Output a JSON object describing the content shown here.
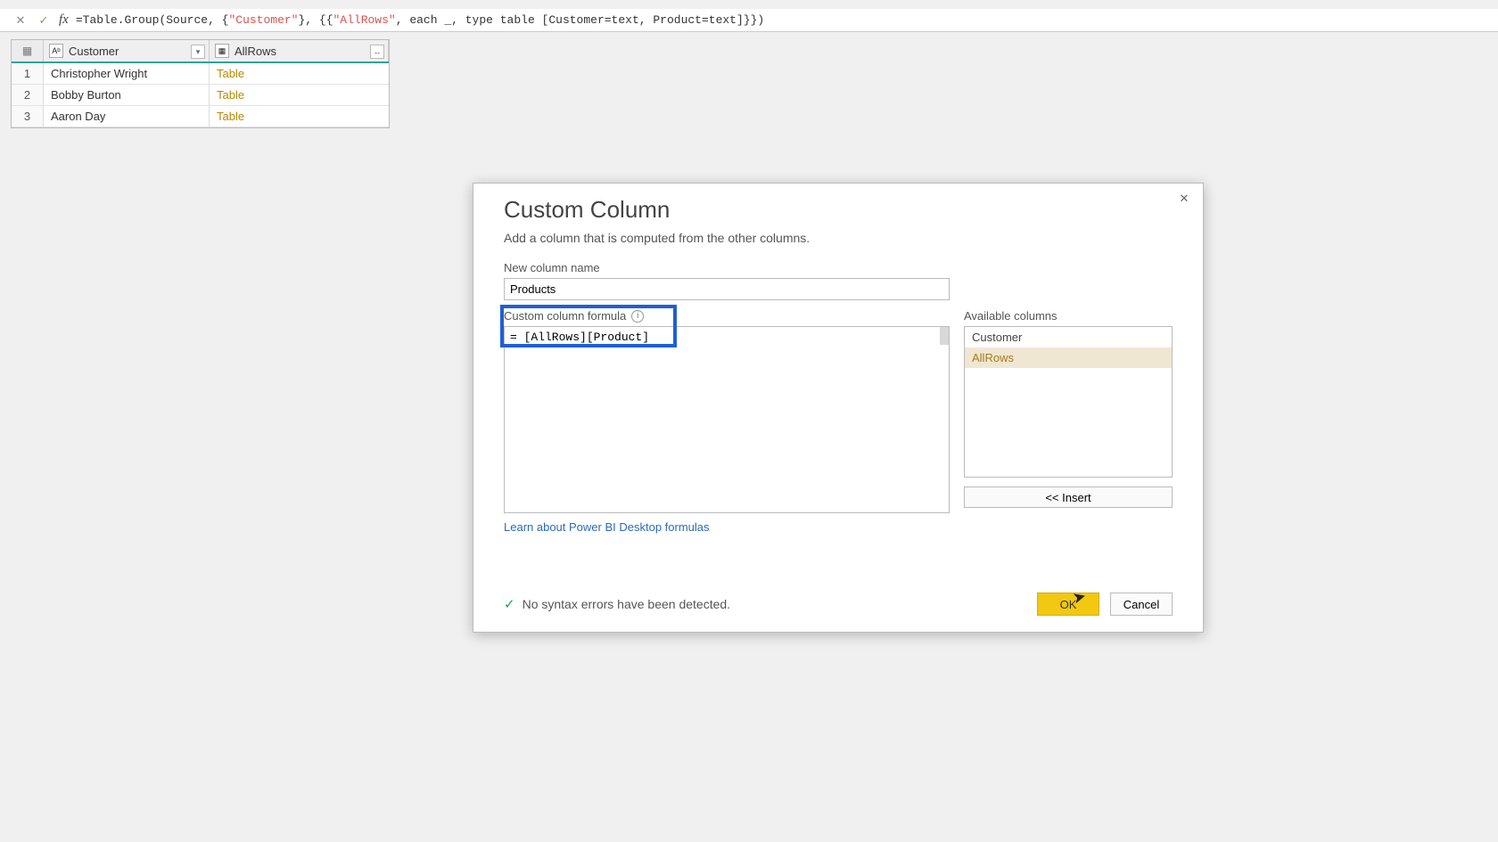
{
  "formula_bar": {
    "prefix": "= ",
    "fn1": "Table.Group(Source, {",
    "str1": "\"Customer\"",
    "mid1": "}, {{",
    "str2": "\"AllRows\"",
    "mid2": ", each _, type table [Customer=text, Product=text]}})"
  },
  "preview": {
    "type_badge1": "Aᵇ",
    "type_badge2": "▦",
    "col1": "Customer",
    "col2": "AllRows",
    "rows": [
      {
        "n": "1",
        "customer": "Christopher Wright",
        "allrows": "Table"
      },
      {
        "n": "2",
        "customer": "Bobby Burton",
        "allrows": "Table"
      },
      {
        "n": "3",
        "customer": "Aaron Day",
        "allrows": "Table"
      }
    ]
  },
  "modal": {
    "title": "Custom Column",
    "subtitle": "Add a column that is computed from the other columns.",
    "new_col_label": "New column name",
    "new_col_value": "Products",
    "formula_label": "Custom column formula",
    "formula_value": "= [AllRows][Product]",
    "available_label": "Available columns",
    "available": [
      "Customer",
      "AllRows"
    ],
    "insert_label": "<< Insert",
    "learn_link": "Learn about Power BI Desktop formulas",
    "status_text": "No syntax errors have been detected.",
    "ok_label": "OK",
    "cancel_label": "Cancel"
  }
}
